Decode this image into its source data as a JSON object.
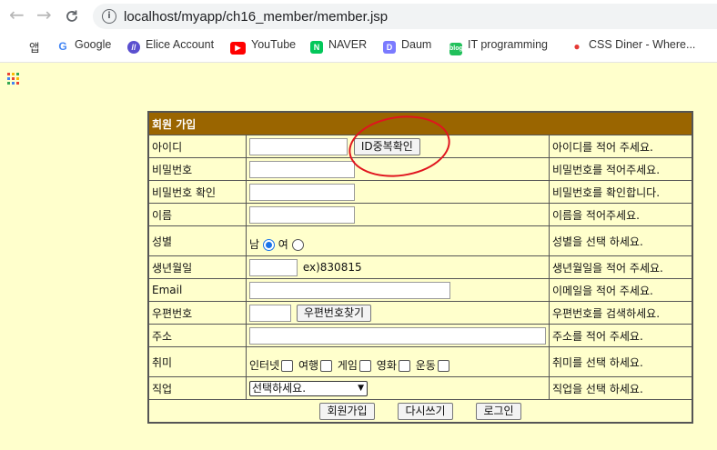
{
  "browser": {
    "url": "localhost/myapp/ch16_member/member.jsp",
    "back_icon": "←",
    "forward_icon": "→",
    "bookmarks": [
      {
        "label": "앱",
        "icon": "apps-grid-icon"
      },
      {
        "label": "Google",
        "icon": "google-icon",
        "glyph": "G",
        "color": "#4285f4"
      },
      {
        "label": "Elice Account",
        "icon": "elice-icon",
        "glyph": "//",
        "color": "#5a4fcf"
      },
      {
        "label": "YouTube",
        "icon": "youtube-icon",
        "glyph": "▶",
        "color": "#ff0000"
      },
      {
        "label": "NAVER",
        "icon": "naver-icon",
        "glyph": "N",
        "color": "#03c75a"
      },
      {
        "label": "Daum",
        "icon": "daum-icon",
        "glyph": "D",
        "color": "#7a7aff"
      },
      {
        "label": "IT programming",
        "icon": "blog-icon",
        "glyph": "b",
        "color": "#21c05b"
      },
      {
        "label": "CSS Diner - Where...",
        "icon": "css-diner-icon",
        "glyph": "●",
        "color": "#e53935"
      }
    ]
  },
  "form": {
    "title": "회원 가입",
    "rows": {
      "id": {
        "label": "아이디",
        "button": "ID중복확인",
        "help": "아이디를 적어 주세요."
      },
      "pw": {
        "label": "비밀번호",
        "help": "비밀번호를 적어주세요."
      },
      "pw2": {
        "label": "비밀번호 확인",
        "help": "비밀번호를 확인합니다."
      },
      "name": {
        "label": "이름",
        "help": "이름을 적어주세요."
      },
      "gender": {
        "label": "성별",
        "male": "남",
        "female": "여",
        "help": "성별을 선택 하세요."
      },
      "birth": {
        "label": "생년월일",
        "example": "ex)830815",
        "help": "생년월일을 적어 주세요."
      },
      "email": {
        "label": "Email",
        "help": "이메일을 적어 주세요."
      },
      "zip": {
        "label": "우편번호",
        "button": "우편번호찾기",
        "help": "우편번호를 검색하세요."
      },
      "addr": {
        "label": "주소",
        "help": "주소를 적어 주세요."
      },
      "hobby": {
        "label": "취미",
        "options": [
          "인터넷",
          "여행",
          "게임",
          "영화",
          "운동"
        ],
        "help": "취미를 선택 하세요."
      },
      "job": {
        "label": "직업",
        "selected": "선택하세요.",
        "help": "직업을 선택 하세요."
      }
    },
    "buttons": {
      "join": "회원가입",
      "reset": "다시쓰기",
      "login": "로그인"
    }
  }
}
